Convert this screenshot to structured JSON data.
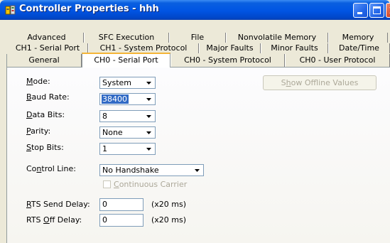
{
  "window": {
    "title": "Controller Properties - hhh"
  },
  "tabs": {
    "row1": [
      "Advanced",
      "SFC Execution",
      "File",
      "Nonvolatile Memory",
      "Memory"
    ],
    "row2": [
      "CH1 - Serial Port",
      "CH1 - System Protocol",
      "Major Faults",
      "Minor Faults",
      "Date/Time"
    ],
    "row3": [
      "General",
      "CH0 - Serial Port",
      "CH0 - System Protocol",
      "CH0 - User Protocol"
    ],
    "active": "CH0 - Serial Port"
  },
  "form": {
    "mode": {
      "accel": "M",
      "rest": "ode:",
      "value": "System"
    },
    "baud_rate": {
      "accel": "B",
      "rest": "aud Rate:",
      "value": "38400"
    },
    "data_bits": {
      "accel": "D",
      "rest": "ata Bits:",
      "value": "8"
    },
    "parity": {
      "accel": "P",
      "rest": "arity:",
      "value": "None"
    },
    "stop_bits": {
      "accel": "S",
      "rest": "top Bits:",
      "value": "1"
    },
    "control_line": {
      "pre": "Co",
      "accel": "n",
      "rest": "trol Line:",
      "value": "No Handshake"
    },
    "continuous_carrier": {
      "accel": "C",
      "rest": "ontinuous Carrier",
      "checked": false,
      "enabled": false
    },
    "rts_send_delay": {
      "accel": "R",
      "rest": "TS Send Delay:",
      "value": "0",
      "unit": "(x20 ms)"
    },
    "rts_off_delay": {
      "pre": "RTS ",
      "accel": "O",
      "rest": "ff Delay:",
      "value": "0",
      "unit": "(x20 ms)"
    },
    "show_offline": {
      "pre": "S",
      "accel": "h",
      "rest": "ow Offline Values",
      "enabled": false
    }
  }
}
